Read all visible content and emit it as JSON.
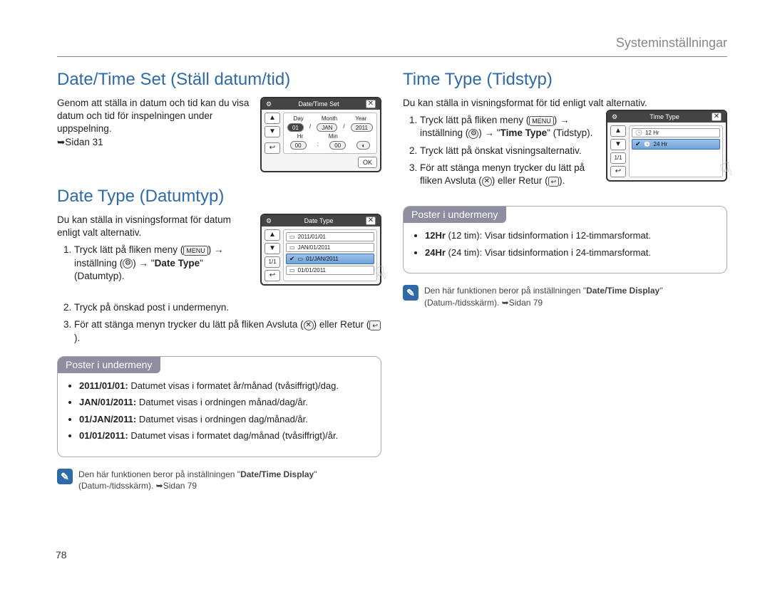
{
  "header": {
    "breadcrumb": "Systeminställningar"
  },
  "page_number": "78",
  "left": {
    "section1": {
      "title": "Date/Time Set (Ställ datum/tid)",
      "body": "Genom att ställa in datum och tid kan du visa datum och tid för inspelningen under uppspelning.",
      "ref": "➥Sidan 31"
    },
    "section2": {
      "title": "Date Type (Datumtyp)",
      "intro": "Du kan ställa in visningsformat för datum enligt valt alternativ.",
      "steps": {
        "s1a": "Tryck lätt på fliken meny (",
        "s1b": ") → inställning (",
        "s1c": ") → \"",
        "s1_term": "Date Type",
        "s1d": "\" (Datumtyp).",
        "s2": "Tryck på önskad post i undermenyn.",
        "s3a": "För att stänga menyn trycker du lätt på fliken Avsluta (",
        "s3b": ") eller Retur (",
        "s3c": ")."
      },
      "submenu": {
        "header": "Poster i undermeny",
        "items": [
          {
            "term": "2011/01/01:",
            "desc": "Datumet visas i formatet år/månad (tvåsiffrigt)/dag."
          },
          {
            "term": "JAN/01/2011:",
            "desc": "Datumet visas i ordningen månad/dag/år."
          },
          {
            "term": "01/JAN/2011:",
            "desc": "Datumet visas i ordningen dag/månad/år."
          },
          {
            "term": "01/01/2011:",
            "desc": "Datumet visas i formatet dag/månad (tvåsiffrigt)/år."
          }
        ]
      },
      "note": {
        "a": "Den här funktionen beror på inställningen \"",
        "term": "Date/Time Display",
        "b": "\" (Datum-/tidsskärm). ➥Sidan 79"
      }
    },
    "lcd1": {
      "title": "Date/Time Set",
      "labels": {
        "day": "Day",
        "month": "Month",
        "year": "Year",
        "hr": "Hr",
        "min": "Min"
      },
      "vals": {
        "day": "01",
        "month": "JAN",
        "year": "2011",
        "hr": "00",
        "min": "00"
      },
      "ok": "OK"
    },
    "lcd2": {
      "title": "Date Type",
      "pager": "1/1",
      "rows": {
        "r1": "2011/01/01",
        "r2": "JAN/01/2011",
        "r3": "01/JAN/2011",
        "r4": "01/01/2011"
      }
    }
  },
  "right": {
    "section": {
      "title": "Time Type (Tidstyp)",
      "intro": "Du kan ställa in visningsformat för tid enligt valt alternativ.",
      "steps": {
        "s1a": "Tryck lätt på fliken meny (",
        "s1b": ") → inställning (",
        "s1c": ") → \"",
        "s1_term": "Time Type",
        "s1d": "\" (Tidstyp).",
        "s2": "Tryck lätt på önskat visningsalternativ.",
        "s3a": "För att stänga menyn trycker du lätt på fliken Avsluta (",
        "s3b": ") eller Retur (",
        "s3c": ")."
      },
      "submenu": {
        "header": "Poster i undermeny",
        "items": [
          {
            "term": "12Hr",
            "after": "(12 tim): Visar tidsinformation i 12-timmarsformat."
          },
          {
            "term": "24Hr",
            "after": "(24 tim): Visar tidsinformation i 24-timmarsformat."
          }
        ]
      },
      "note": {
        "a": "Den här funktionen beror på inställningen \"",
        "term": "Date/Time Display",
        "b": "\" (Datum-/tidsskärm). ➥Sidan 79"
      }
    },
    "lcd": {
      "title": "Time Type",
      "pager": "1/1",
      "rows": {
        "r1": "12 Hr",
        "r2": "24 Hr"
      }
    }
  },
  "icons": {
    "menu": "MENU",
    "x": "✕",
    "return": "↩",
    "gear": "⚙",
    "note": "✎"
  }
}
